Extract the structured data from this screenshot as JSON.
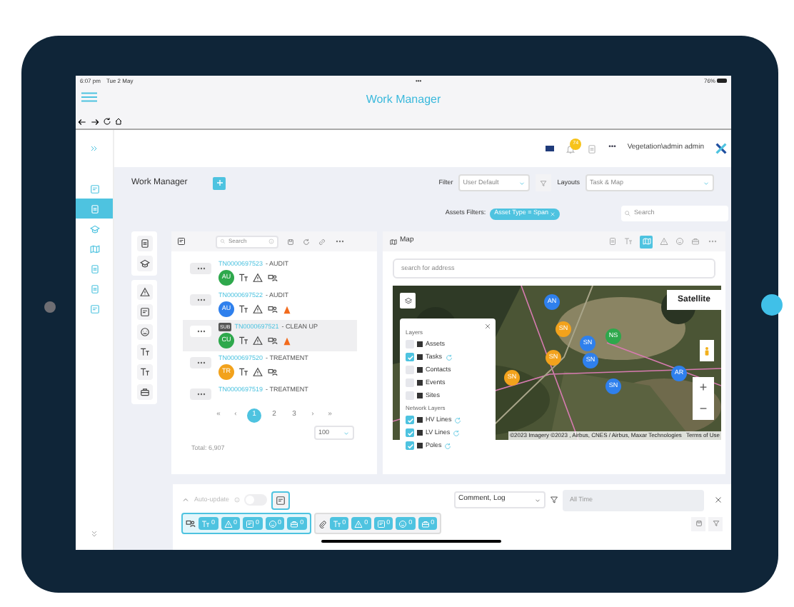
{
  "status_bar": {
    "time": "6:07 pm",
    "date": "Tue 2 May",
    "dots": "•••",
    "battery": "76%"
  },
  "app_title": "Work Manager",
  "sidebar": {
    "items": [
      {
        "selected": false
      },
      {
        "selected": true
      },
      {
        "selected": false
      },
      {
        "selected": false
      },
      {
        "selected": false
      },
      {
        "selected": false
      },
      {
        "selected": false
      }
    ]
  },
  "header": {
    "notifications": "74",
    "dots": "•••",
    "user": "Vegetation\\admin admin"
  },
  "toolbar": {
    "title": "Work Manager",
    "filter_label": "Filter",
    "filter_value": "User Default",
    "layouts_label": "Layouts",
    "layouts_value": "Task & Map"
  },
  "assets_filters": {
    "label": "Assets Filters:",
    "chip": "Asset Type = Span",
    "search_placeholder": "Search"
  },
  "tasks": {
    "search_placeholder": "Search",
    "items": [
      {
        "id": "TN0000697523",
        "type": "- AUDIT",
        "avatar": "AU",
        "color": "#2ea84c",
        "selected": false,
        "cone": false
      },
      {
        "id": "TN0000697522",
        "type": "- AUDIT",
        "avatar": "AU",
        "color": "#2f80ed",
        "selected": false,
        "cone": true
      },
      {
        "id": "TN0000697521",
        "type": "- CLEAN UP",
        "avatar": "CU",
        "color": "#2ea84c",
        "selected": true,
        "badge": "SUB",
        "cone": true
      },
      {
        "id": "TN0000697520",
        "type": "- TREATMENT",
        "avatar": "TR",
        "color": "#f2a21c",
        "selected": false,
        "cone": false
      },
      {
        "id": "TN0000697519",
        "type": "- TREATMENT",
        "selected": false
      }
    ],
    "pager": {
      "first": "«",
      "prev": "‹",
      "pages": [
        {
          "label": "1",
          "selected": true
        },
        {
          "label": "2",
          "selected": false
        },
        {
          "label": "3",
          "selected": false
        }
      ],
      "next": "›",
      "last": "»"
    },
    "page_size": "100",
    "total": "Total: 6,907"
  },
  "map": {
    "title": "Map",
    "search_placeholder": "search for address",
    "satellite": "Satellite",
    "markers": [
      {
        "label": "AN",
        "color": "#2f80ed"
      },
      {
        "label": "SN",
        "color": "#f2a21c"
      },
      {
        "label": "NS",
        "color": "#2ea84c"
      },
      {
        "label": "SN",
        "color": "#2f80ed"
      },
      {
        "label": "SN",
        "color": "#2f80ed"
      },
      {
        "label": "SN",
        "color": "#f2a21c"
      },
      {
        "label": "SN",
        "color": "#f2a21c"
      },
      {
        "label": "SN",
        "color": "#2f80ed"
      },
      {
        "label": "AR",
        "color": "#2f80ed"
      }
    ],
    "layers": {
      "title": "Layers",
      "items": [
        {
          "label": "Assets",
          "checked": false,
          "sync": false
        },
        {
          "label": "Tasks",
          "checked": true,
          "sync": true
        },
        {
          "label": "Contacts",
          "checked": false,
          "sync": false
        },
        {
          "label": "Events",
          "checked": false,
          "sync": false
        },
        {
          "label": "Sites",
          "checked": false,
          "sync": false
        }
      ],
      "network_title": "Network Layers",
      "network_items": [
        {
          "label": "HV Lines",
          "checked": true,
          "sync": true
        },
        {
          "label": "LV Lines",
          "checked": true,
          "sync": true
        },
        {
          "label": "Poles",
          "checked": true,
          "sync": true
        }
      ]
    },
    "zoom_in": "+",
    "zoom_out": "−",
    "attribution": "©2023 Imagery ©2023 , Airbus, CNES / Airbus, Maxar Technologies",
    "terms": "Terms of Use"
  },
  "bottom": {
    "auto_update": {
      "label": "Auto-update",
      "on": false
    },
    "types": "Comment, Log",
    "time_placeholder": "All Time",
    "groups": [
      {
        "counts": [
          "0",
          "0",
          "0",
          "0",
          "0"
        ]
      },
      {
        "counts": [
          "0",
          "0",
          "0",
          "0",
          "0"
        ]
      }
    ]
  }
}
